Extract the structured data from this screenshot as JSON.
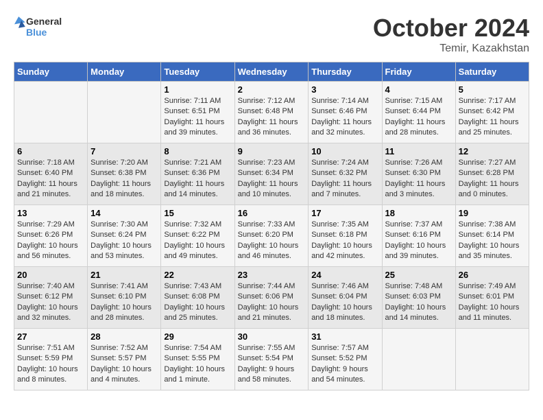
{
  "header": {
    "logo_general": "General",
    "logo_blue": "Blue",
    "month_year": "October 2024",
    "location": "Temir, Kazakhstan"
  },
  "weekdays": [
    "Sunday",
    "Monday",
    "Tuesday",
    "Wednesday",
    "Thursday",
    "Friday",
    "Saturday"
  ],
  "weeks": [
    [
      {
        "day": "",
        "info": ""
      },
      {
        "day": "",
        "info": ""
      },
      {
        "day": "1",
        "info": "Sunrise: 7:11 AM\nSunset: 6:51 PM\nDaylight: 11 hours and 39 minutes."
      },
      {
        "day": "2",
        "info": "Sunrise: 7:12 AM\nSunset: 6:48 PM\nDaylight: 11 hours and 36 minutes."
      },
      {
        "day": "3",
        "info": "Sunrise: 7:14 AM\nSunset: 6:46 PM\nDaylight: 11 hours and 32 minutes."
      },
      {
        "day": "4",
        "info": "Sunrise: 7:15 AM\nSunset: 6:44 PM\nDaylight: 11 hours and 28 minutes."
      },
      {
        "day": "5",
        "info": "Sunrise: 7:17 AM\nSunset: 6:42 PM\nDaylight: 11 hours and 25 minutes."
      }
    ],
    [
      {
        "day": "6",
        "info": "Sunrise: 7:18 AM\nSunset: 6:40 PM\nDaylight: 11 hours and 21 minutes."
      },
      {
        "day": "7",
        "info": "Sunrise: 7:20 AM\nSunset: 6:38 PM\nDaylight: 11 hours and 18 minutes."
      },
      {
        "day": "8",
        "info": "Sunrise: 7:21 AM\nSunset: 6:36 PM\nDaylight: 11 hours and 14 minutes."
      },
      {
        "day": "9",
        "info": "Sunrise: 7:23 AM\nSunset: 6:34 PM\nDaylight: 11 hours and 10 minutes."
      },
      {
        "day": "10",
        "info": "Sunrise: 7:24 AM\nSunset: 6:32 PM\nDaylight: 11 hours and 7 minutes."
      },
      {
        "day": "11",
        "info": "Sunrise: 7:26 AM\nSunset: 6:30 PM\nDaylight: 11 hours and 3 minutes."
      },
      {
        "day": "12",
        "info": "Sunrise: 7:27 AM\nSunset: 6:28 PM\nDaylight: 11 hours and 0 minutes."
      }
    ],
    [
      {
        "day": "13",
        "info": "Sunrise: 7:29 AM\nSunset: 6:26 PM\nDaylight: 10 hours and 56 minutes."
      },
      {
        "day": "14",
        "info": "Sunrise: 7:30 AM\nSunset: 6:24 PM\nDaylight: 10 hours and 53 minutes."
      },
      {
        "day": "15",
        "info": "Sunrise: 7:32 AM\nSunset: 6:22 PM\nDaylight: 10 hours and 49 minutes."
      },
      {
        "day": "16",
        "info": "Sunrise: 7:33 AM\nSunset: 6:20 PM\nDaylight: 10 hours and 46 minutes."
      },
      {
        "day": "17",
        "info": "Sunrise: 7:35 AM\nSunset: 6:18 PM\nDaylight: 10 hours and 42 minutes."
      },
      {
        "day": "18",
        "info": "Sunrise: 7:37 AM\nSunset: 6:16 PM\nDaylight: 10 hours and 39 minutes."
      },
      {
        "day": "19",
        "info": "Sunrise: 7:38 AM\nSunset: 6:14 PM\nDaylight: 10 hours and 35 minutes."
      }
    ],
    [
      {
        "day": "20",
        "info": "Sunrise: 7:40 AM\nSunset: 6:12 PM\nDaylight: 10 hours and 32 minutes."
      },
      {
        "day": "21",
        "info": "Sunrise: 7:41 AM\nSunset: 6:10 PM\nDaylight: 10 hours and 28 minutes."
      },
      {
        "day": "22",
        "info": "Sunrise: 7:43 AM\nSunset: 6:08 PM\nDaylight: 10 hours and 25 minutes."
      },
      {
        "day": "23",
        "info": "Sunrise: 7:44 AM\nSunset: 6:06 PM\nDaylight: 10 hours and 21 minutes."
      },
      {
        "day": "24",
        "info": "Sunrise: 7:46 AM\nSunset: 6:04 PM\nDaylight: 10 hours and 18 minutes."
      },
      {
        "day": "25",
        "info": "Sunrise: 7:48 AM\nSunset: 6:03 PM\nDaylight: 10 hours and 14 minutes."
      },
      {
        "day": "26",
        "info": "Sunrise: 7:49 AM\nSunset: 6:01 PM\nDaylight: 10 hours and 11 minutes."
      }
    ],
    [
      {
        "day": "27",
        "info": "Sunrise: 7:51 AM\nSunset: 5:59 PM\nDaylight: 10 hours and 8 minutes."
      },
      {
        "day": "28",
        "info": "Sunrise: 7:52 AM\nSunset: 5:57 PM\nDaylight: 10 hours and 4 minutes."
      },
      {
        "day": "29",
        "info": "Sunrise: 7:54 AM\nSunset: 5:55 PM\nDaylight: 10 hours and 1 minute."
      },
      {
        "day": "30",
        "info": "Sunrise: 7:55 AM\nSunset: 5:54 PM\nDaylight: 9 hours and 58 minutes."
      },
      {
        "day": "31",
        "info": "Sunrise: 7:57 AM\nSunset: 5:52 PM\nDaylight: 9 hours and 54 minutes."
      },
      {
        "day": "",
        "info": ""
      },
      {
        "day": "",
        "info": ""
      }
    ]
  ]
}
